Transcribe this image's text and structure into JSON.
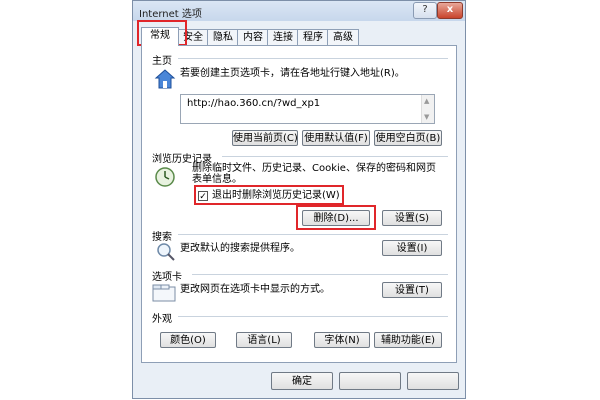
{
  "dialog": {
    "title": "Internet 选项",
    "help_label": "?",
    "close_label": "x"
  },
  "tabs": [
    "常规",
    "安全",
    "隐私",
    "内容",
    "连接",
    "程序",
    "高级"
  ],
  "home": {
    "section_label": "主页",
    "description": "若要创建主页选项卡，请在各地址行键入地址(R)。",
    "url": "http://hao.360.cn/?wd_xp1",
    "buttons": [
      "使用当前页(C)",
      "使用默认值(F)",
      "使用空白页(B)"
    ]
  },
  "history": {
    "section_label": "浏览历史记录",
    "description_line1": "删除临时文件、历史记录、Cookie、保存的密码和网页",
    "description_line2": "表单信息。",
    "checkbox_label": "退出时删除浏览历史记录(W)",
    "checkbox_checked": true,
    "check_mark": "✓",
    "delete_label": "删除(D)...",
    "settings_label": "设置(S)"
  },
  "search": {
    "section_label": "搜索",
    "description": "更改默认的搜索提供程序。",
    "settings_label": "设置(I)"
  },
  "tabs_section": {
    "section_label": "选项卡",
    "description": "更改网页在选项卡中显示的方式。",
    "settings_label": "设置(T)"
  },
  "appearance": {
    "section_label": "外观",
    "buttons": [
      "颜色(O)",
      "语言(L)",
      "字体(N)",
      "辅助功能(E)"
    ]
  },
  "footer": {
    "ok_label": "确定"
  },
  "colors": {
    "highlight": "#e0262a",
    "accent": "#2b6cc4"
  }
}
